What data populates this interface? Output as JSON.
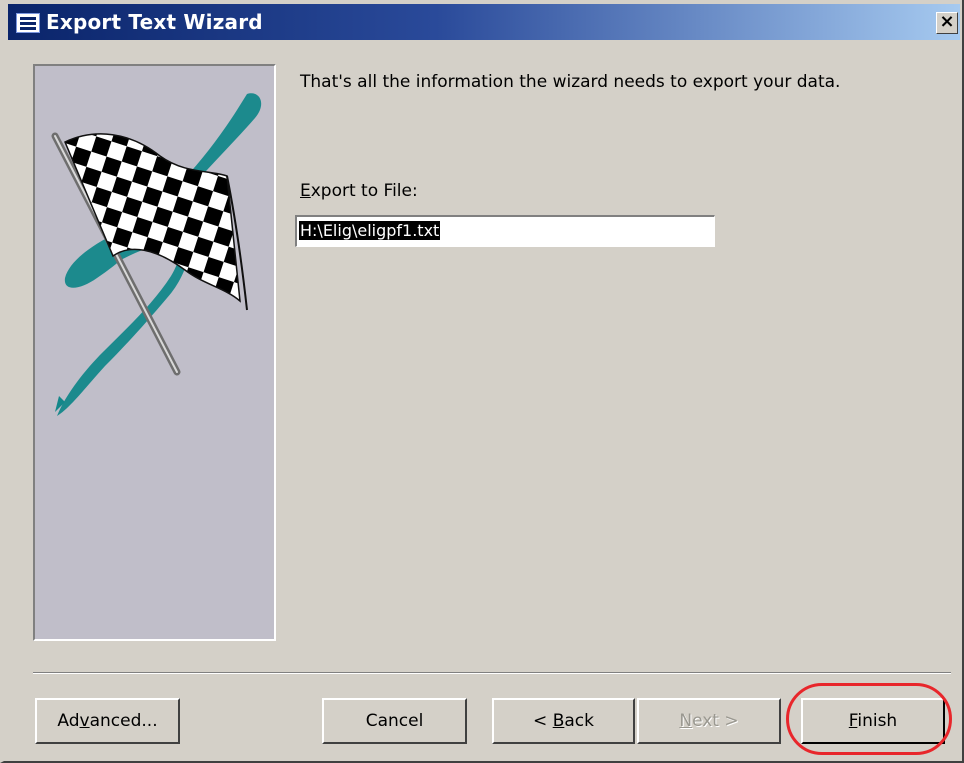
{
  "window": {
    "title": "Export Text Wizard",
    "close_glyph": "×"
  },
  "content": {
    "intro": "That's all the information the wizard needs to export your data.",
    "export_label": "Export to File:",
    "export_value": "H:\\Elig\\eligpf1.txt"
  },
  "buttons": {
    "advanced": "Advanced...",
    "cancel": "Cancel",
    "back": "< Back",
    "next": "Next >",
    "finish": "Finish"
  },
  "colors": {
    "accent_circle": "#e8262b",
    "flag_swoosh": "#13878a",
    "title_bar": "#0a246a"
  },
  "icons": {
    "window_icon": "form-icon",
    "wizard_graphic": "checkered-flag-icon"
  }
}
